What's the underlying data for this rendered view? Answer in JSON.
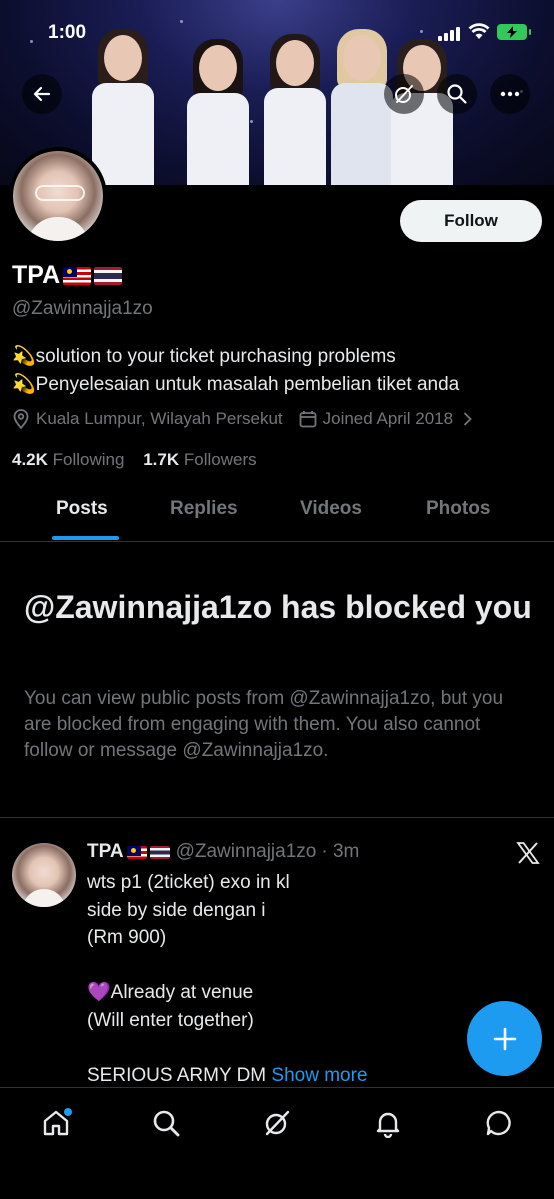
{
  "status_bar": {
    "time": "1:00"
  },
  "header": {
    "back_icon": "arrow-left-icon",
    "grok_icon": "grok-icon",
    "search_icon": "search-icon",
    "more_icon": "more-horizontal-icon"
  },
  "profile": {
    "name": "TPA",
    "flags": [
      "Malaysia",
      "Thailand"
    ],
    "handle": "@Zawinnajja1zo",
    "follow_label": "Follow",
    "bio_line1": "💫solution to your ticket purchasing problems",
    "bio_line2": "💫Penyelesaian untuk masalah pembelian tiket anda",
    "location": "Kuala Lumpur, Wilayah Persekut",
    "joined": "Joined April 2018",
    "following_count": "4.2K",
    "following_label": "Following",
    "followers_count": "1.7K",
    "followers_label": "Followers"
  },
  "tabs": [
    {
      "label": "Posts",
      "active": true
    },
    {
      "label": "Replies",
      "active": false
    },
    {
      "label": "Videos",
      "active": false
    },
    {
      "label": "Photos",
      "active": false
    }
  ],
  "blocked": {
    "title": "@Zawinnajja1zo has blocked you",
    "description": "You can view public posts from @Zawinnajja1zo, but you are blocked from engaging with them. You also cannot follow or message @Zawinnajja1zo."
  },
  "post": {
    "name": "TPA",
    "handle": "@Zawinnajja1zo",
    "time": "· 3m",
    "line1": "wts p1 (2ticket) exo in kl",
    "line2": "side by side dengan i",
    "line3": "(Rm 900)",
    "line4": "💜Already at venue",
    "line5": "(Will enter together)",
    "line6": "SERIOUS ARMY DM",
    "show_more": "Show more"
  },
  "colors": {
    "accent": "#1d9bf0",
    "background": "#000000",
    "text_primary": "#e7e9ea",
    "text_secondary": "#71767b",
    "border": "#2f3336"
  },
  "bottom_nav": [
    "home-icon",
    "search-icon",
    "grok-icon",
    "notifications-icon",
    "messages-icon"
  ]
}
